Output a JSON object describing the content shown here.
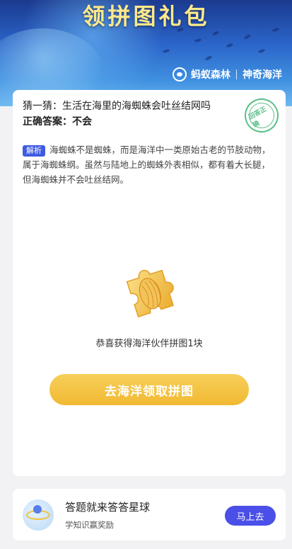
{
  "banner": {
    "title": "领拼图礼包",
    "brand_left": "蚂蚁森林",
    "brand_right": "神奇海洋"
  },
  "quiz": {
    "question": "猜一猜：生活在海里的海蜘蛛会吐丝结网吗",
    "answer": "正确答案：不会",
    "stamp": "回答正确",
    "explain_tag": "解析",
    "explain_text": "海蜘蛛不是蜘蛛，而是海洋中一类原始古老的节肢动物，属于海蜘蛛纲。虽然与陆地上的蜘蛛外表相似，都有着大长腿，但海蜘蛛并不会吐丝结网。",
    "reward_text": "恭喜获得海洋伙伴拼图1块",
    "cta_label": "去海洋领取拼图"
  },
  "promo": {
    "title": "答题就来答答星球",
    "subtitle": "学知识赢奖励",
    "button": "马上去"
  },
  "colors": {
    "accent": "#4a4fe8",
    "cta": "#f1b932",
    "stamp": "#5cc08a",
    "tag": "#3f5be0"
  }
}
